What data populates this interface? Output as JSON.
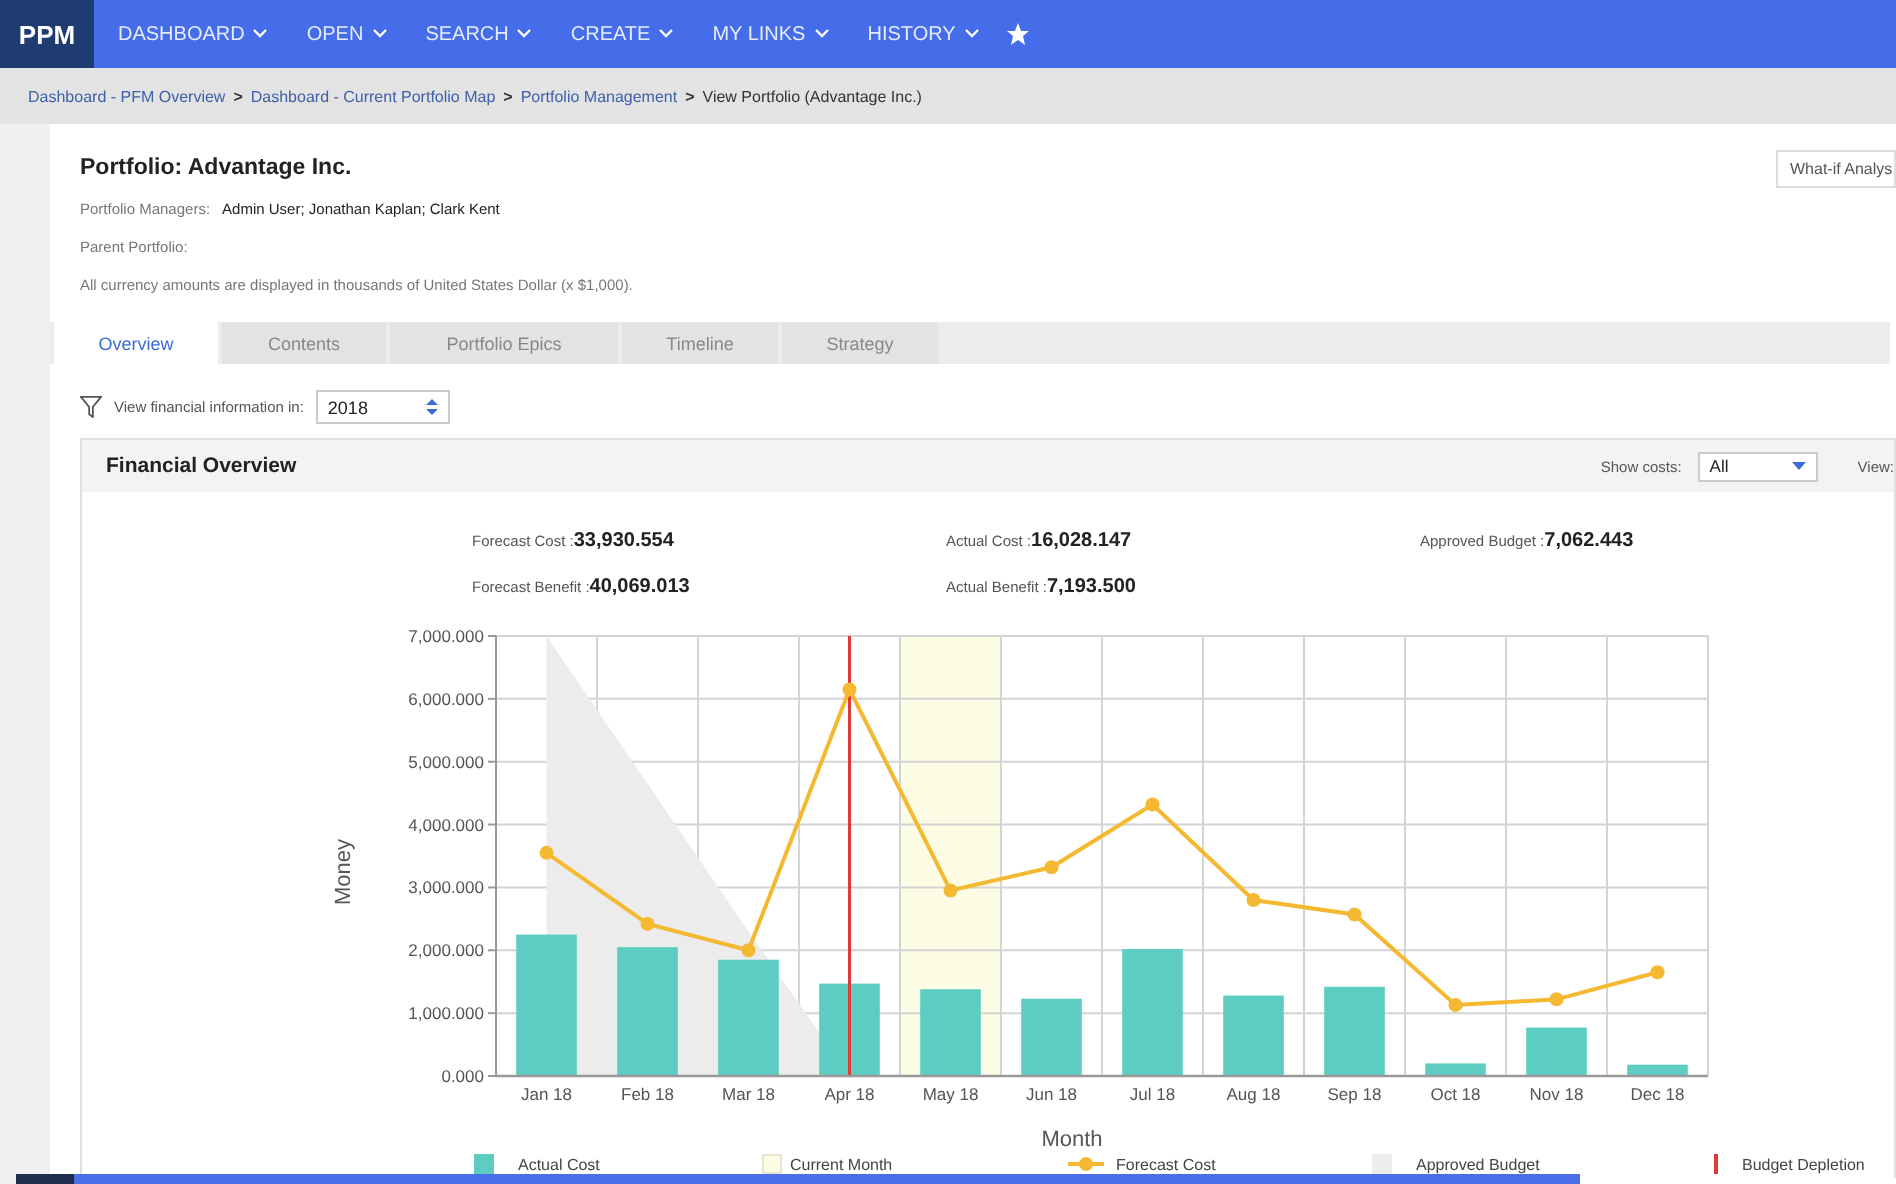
{
  "nav": {
    "logo": "PPM",
    "menus": [
      "DASHBOARD",
      "OPEN",
      "SEARCH",
      "CREATE",
      "MY LINKS",
      "HISTORY"
    ]
  },
  "breadcrumb": {
    "links": [
      "Dashboard - PFM Overview",
      "Dashboard - Current Portfolio Map",
      "Portfolio Management"
    ],
    "separator": ">",
    "current": "View Portfolio (Advantage Inc.)"
  },
  "portfolio": {
    "title": "Portfolio: Advantage Inc.",
    "action_button": "What-if Analys",
    "fields": [
      {
        "label": "Portfolio Managers:",
        "value": "Admin User; Jonathan Kaplan; Clark Kent"
      },
      {
        "label": "Parent Portfolio:"
      }
    ],
    "note": "All currency amounts are displayed in thousands of United States Dollar (x $1,000)."
  },
  "tabs": [
    {
      "label": "Overview",
      "selected": true
    },
    {
      "label": "Contents",
      "selected": false
    },
    {
      "label": "Portfolio Epics",
      "selected": false
    },
    {
      "label": "Timeline",
      "selected": false
    },
    {
      "label": "Strategy",
      "selected": false
    }
  ],
  "filter": {
    "label": "View financial information in:",
    "value": "2018"
  },
  "financial_overview": {
    "title": "Financial Overview",
    "show_costs": {
      "label": "Show costs:",
      "value": "All"
    },
    "view_label": "View:",
    "metric_columns": [
      [
        {
          "label": "Forecast Cost :",
          "value": "33,930.554"
        },
        {
          "label": "Forecast Benefit :",
          "value": "40,069.013"
        }
      ],
      [
        {
          "label": "Actual Cost :",
          "value": "16,028.147"
        },
        {
          "label": "Actual Benefit :",
          "value": "7,193.500"
        }
      ],
      [
        {
          "label": "Approved Budget :",
          "value": "7,062.443"
        }
      ]
    ],
    "chart_data": {
      "type": "bar",
      "xlabel": "Month",
      "ylabel": "Money",
      "categories": [
        "Jan 18",
        "Feb 18",
        "Mar 18",
        "Apr 18",
        "May 18",
        "Jun 18",
        "Jul 18",
        "Aug 18",
        "Sep 18",
        "Oct 18",
        "Nov 18",
        "Dec 18"
      ],
      "ylim": [
        0,
        7000
      ],
      "grid": true,
      "legend": "bottom",
      "yticks": [
        {
          "value": 0,
          "label": "0.000"
        },
        {
          "value": 1000,
          "label": "1,000.000"
        },
        {
          "value": 2000,
          "label": "2,000.000"
        },
        {
          "value": 3000,
          "label": "3,000.000"
        },
        {
          "value": 4000,
          "label": "4,000.000"
        },
        {
          "value": 5000,
          "label": "5,000.000"
        },
        {
          "value": 6000,
          "label": "6,000.000"
        },
        {
          "value": 7000,
          "label": "7,000.000"
        }
      ],
      "series": [
        {
          "name": "Actual Cost",
          "type": "bar",
          "color": "#5ccdc0",
          "values": [
            2250,
            2050,
            1850,
            1470,
            1380,
            1230,
            2020,
            1280,
            1420,
            200,
            770,
            180
          ]
        },
        {
          "name": "Forecast Cost",
          "type": "line",
          "marker": "circle",
          "color": "#f5b831",
          "values": [
            3550,
            2420,
            2000,
            6150,
            2950,
            3320,
            4320,
            2800,
            2570,
            1130,
            1220,
            1650
          ]
        },
        {
          "name": "Approved Budget",
          "type": "area",
          "color": "#ececec",
          "values": [
            7000,
            4650,
            2300,
            0,
            null,
            null,
            null,
            null,
            null,
            null,
            null,
            null
          ]
        }
      ],
      "bands": [
        {
          "axis": "x",
          "from": "May 18",
          "to": "May 18",
          "label": "Current Month",
          "color": "#fdfde6"
        }
      ],
      "ref_lines": [
        {
          "axis": "x",
          "value": "Apr 18",
          "label": "Budget Depletion",
          "color": "#e03a3a"
        }
      ]
    }
  }
}
